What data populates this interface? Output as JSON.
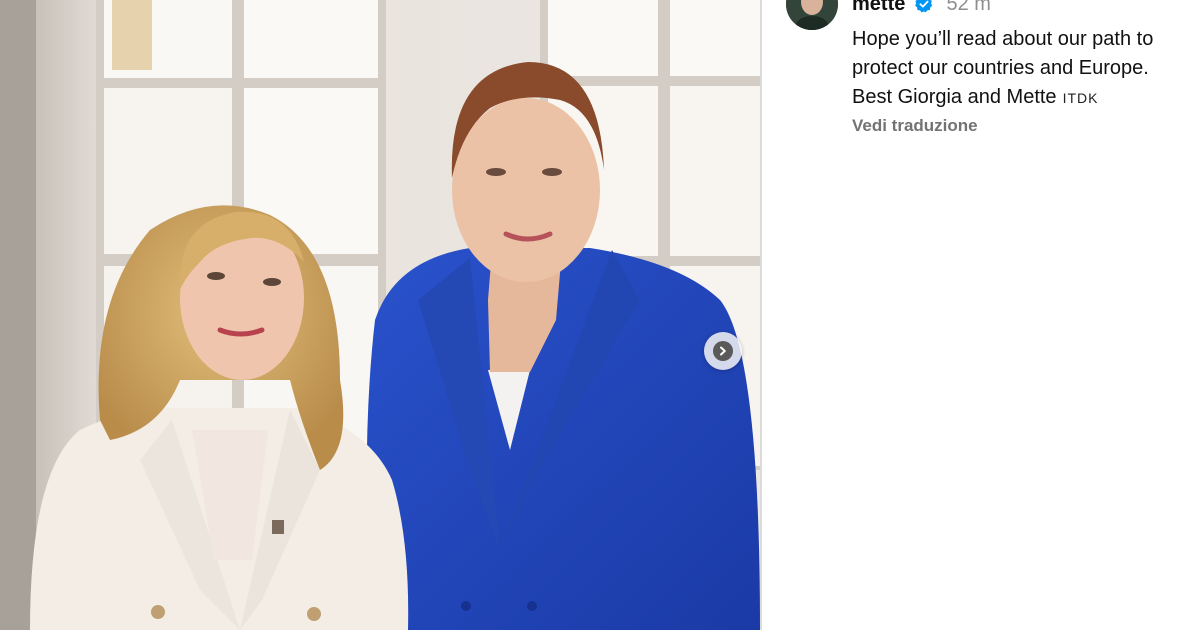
{
  "post": {
    "carousel_next_icon": "chevron-right-icon",
    "carousel_next_label": "Next"
  },
  "comment": {
    "username": "mette",
    "verified_icon": "verified-badge-icon",
    "time": "52 m",
    "caption_lines": [
      "Hope you’ll read about our path to",
      "protect our countries and Europe.",
      "Best Giorgia and Mette"
    ],
    "flags": "ITDK",
    "translate_link": "Vedi traduzione"
  },
  "colors": {
    "text": "#111111",
    "muted": "#8e8e8e",
    "verified_blue": "#0095f6",
    "blue_suit": "#1f44b8",
    "cream_suit": "#f1ebe4"
  }
}
